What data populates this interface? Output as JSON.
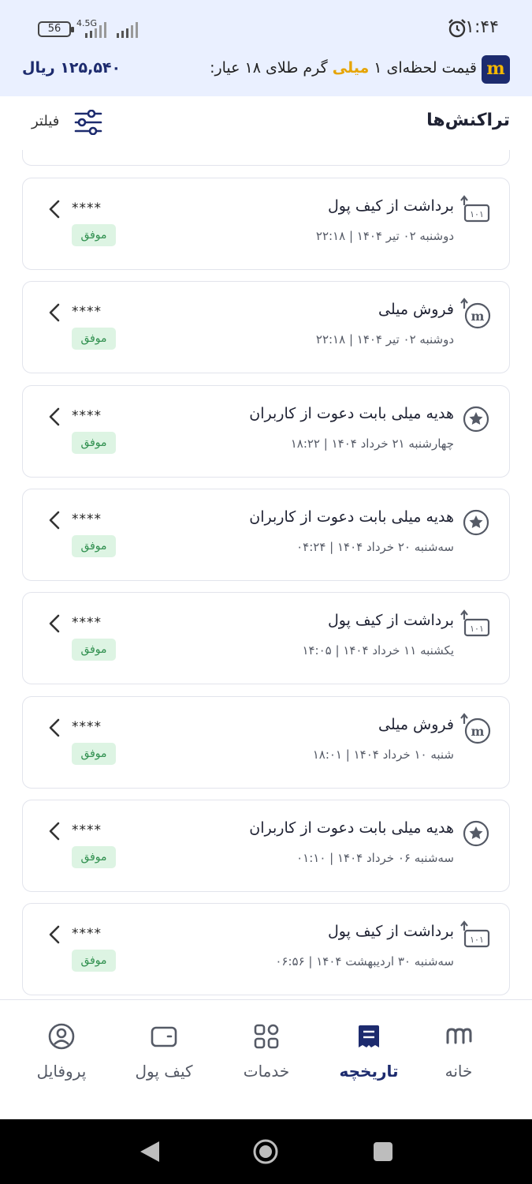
{
  "status_bar": {
    "time": "۱:۴۴",
    "battery": "56",
    "network": "4.5G",
    "icons": [
      "alarm-icon",
      "signal-icon",
      "battery-icon"
    ]
  },
  "gold_banner": {
    "brand_logo": "m",
    "text_before": "قیمت لحظه‌ای ۱ ",
    "text_highlight": "میلی",
    "text_after": " گرم طلای ۱۸ عیار:",
    "price": "۱۲۵,۵۴۰ ریال",
    "highlight_color": "#e6a400"
  },
  "header": {
    "title": "تراکنش‌ها",
    "filter_label": "فیلتر",
    "filter_icon": "sliders-icon"
  },
  "transactions": [
    {
      "icon": "wallet-withdraw-icon",
      "title": "برداشت از کیف پول",
      "date": "دوشنبه ۰۲ تیر ۱۴۰۴ | ۲۲:۱۸",
      "amount": "****",
      "status": "موفق"
    },
    {
      "icon": "milli-sell-icon",
      "title": "فروش میلی",
      "date": "دوشنبه ۰۲ تیر ۱۴۰۴ | ۲۲:۱۸",
      "amount": "****",
      "status": "موفق"
    },
    {
      "icon": "star-gift-icon",
      "title": "هدیه میلی بابت دعوت از کاربران",
      "date": "چهارشنبه ۲۱ خرداد ۱۴۰۴ | ۱۸:۲۲",
      "amount": "****",
      "status": "موفق"
    },
    {
      "icon": "star-gift-icon",
      "title": "هدیه میلی بابت دعوت از کاربران",
      "date": "سه‌شنبه ۲۰ خرداد ۱۴۰۴ | ۰۴:۲۴",
      "amount": "****",
      "status": "موفق"
    },
    {
      "icon": "wallet-withdraw-icon",
      "title": "برداشت از کیف پول",
      "date": "یکشنبه ۱۱ خرداد ۱۴۰۴ | ۱۴:۰۵",
      "amount": "****",
      "status": "موفق"
    },
    {
      "icon": "milli-sell-icon",
      "title": "فروش میلی",
      "date": "شنبه ۱۰ خرداد ۱۴۰۴ | ۱۸:۰۱",
      "amount": "****",
      "status": "موفق"
    },
    {
      "icon": "star-gift-icon",
      "title": "هدیه میلی بابت دعوت از کاربران",
      "date": "سه‌شنبه ۰۶ خرداد ۱۴۰۴ | ۰۱:۱۰",
      "amount": "****",
      "status": "موفق"
    },
    {
      "icon": "wallet-withdraw-icon",
      "title": "برداشت از کیف پول",
      "date": "سه‌شنبه ۳۰ اردیبهشت ۱۴۰۴ | ۰۶:۵۶",
      "amount": "****",
      "status": "موفق"
    }
  ],
  "bottom_nav": [
    {
      "label": "خانه",
      "icon": "home-logo-icon",
      "active": false
    },
    {
      "label": "تاریخچه",
      "icon": "history-icon",
      "active": true
    },
    {
      "label": "خدمات",
      "icon": "grid-icon",
      "active": false
    },
    {
      "label": "کیف پول",
      "icon": "wallet-icon",
      "active": false
    },
    {
      "label": "پروفایل",
      "icon": "profile-icon",
      "active": false
    }
  ],
  "colors": {
    "brand": "#1d2b6e",
    "success_bg": "#ddf4e3",
    "success_text": "#2f8f4e",
    "banner_bg": "#eaf0ff"
  }
}
